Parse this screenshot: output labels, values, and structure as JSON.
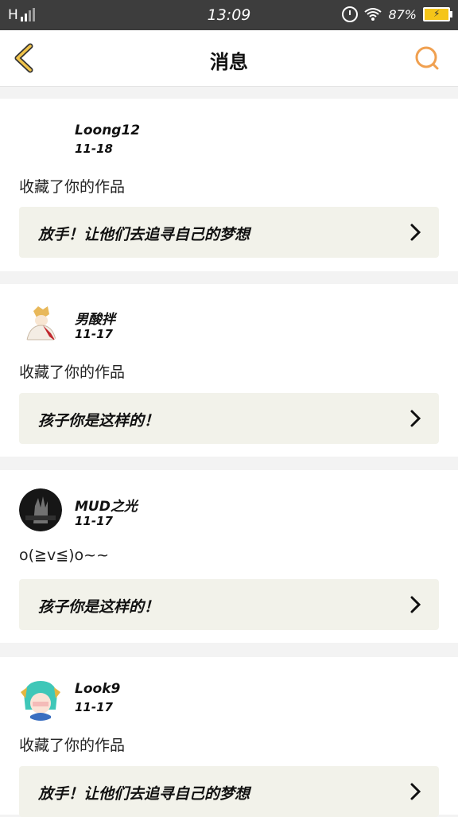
{
  "status_bar": {
    "network": "H",
    "time": "13:09",
    "battery": "87%"
  },
  "header": {
    "title": "消息"
  },
  "messages": [
    {
      "username": "Loong12",
      "date": "11-18",
      "text": "收藏了你的作品",
      "work_title": "放手！让他们去追寻自己的梦想",
      "avatar": "none"
    },
    {
      "username": "男酸拌",
      "date": "11-17",
      "text": "收藏了你的作品",
      "work_title": "孩子你是这样的！",
      "avatar": "anime-character"
    },
    {
      "username": "MUD之光",
      "date": "11-17",
      "text": "o(≧v≦)o~~",
      "work_title": "孩子你是这样的！",
      "avatar": "dark-hand-photo"
    },
    {
      "username": "Look9",
      "date": "11-17",
      "text": "收藏了你的作品",
      "work_title": "放手！让他们去追寻自己的梦想",
      "avatar": "teal-hair-character"
    }
  ],
  "colors": {
    "accent": "#f0c34a",
    "search_accent": "#f0a050",
    "status_bar": "#3d3d3d",
    "work_box": "#f2f2ea"
  }
}
